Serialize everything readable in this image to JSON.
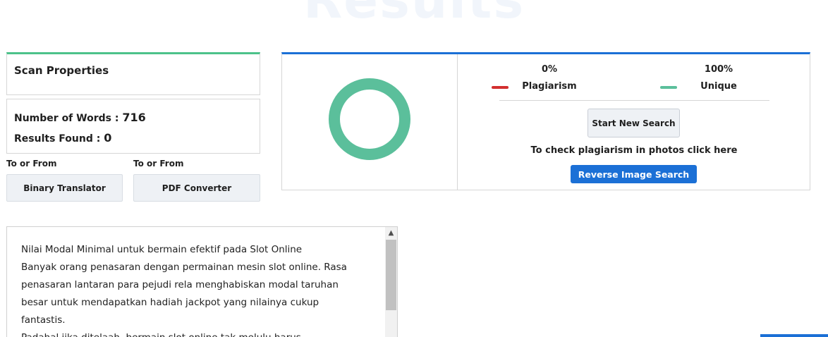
{
  "header": {
    "ghost_title": "Results"
  },
  "scan": {
    "title": "Scan Properties",
    "words_label": "Number of Words : ",
    "words_value": "716",
    "results_label": "Results Found : ",
    "results_value": "0"
  },
  "tools": [
    {
      "label": "To or From",
      "button": "Binary Translator"
    },
    {
      "label": "To or From",
      "button": "PDF Converter"
    }
  ],
  "result": {
    "plagiarism_pct": "0%",
    "unique_pct": "100%",
    "plagiarism_label": "Plagiarism",
    "unique_label": "Unique",
    "plagiarism_value": 0,
    "unique_value": 100,
    "start_button": "Start New Search",
    "photo_text": "To check plagiarism in photos click here",
    "reverse_button": "Reverse Image Search"
  },
  "colors": {
    "plagiarism": "#d32f2f",
    "unique": "#5bbf9b",
    "accent_blue": "#1b70d6",
    "accent_green": "#4cc28a"
  },
  "content": {
    "lines": [
      "Nilai Modal Minimal untuk bermain efektif pada Slot Online",
      "Banyak orang penasaran dengan permainan mesin slot online. Rasa",
      "penasaran lantaran para pejudi rela menghabiskan modal taruhan",
      "besar untuk mendapatkan hadiah jackpot yang nilainya cukup",
      "fantastis.",
      "Padahal jika ditelaah, bermain slot online tak melulu harus"
    ]
  }
}
